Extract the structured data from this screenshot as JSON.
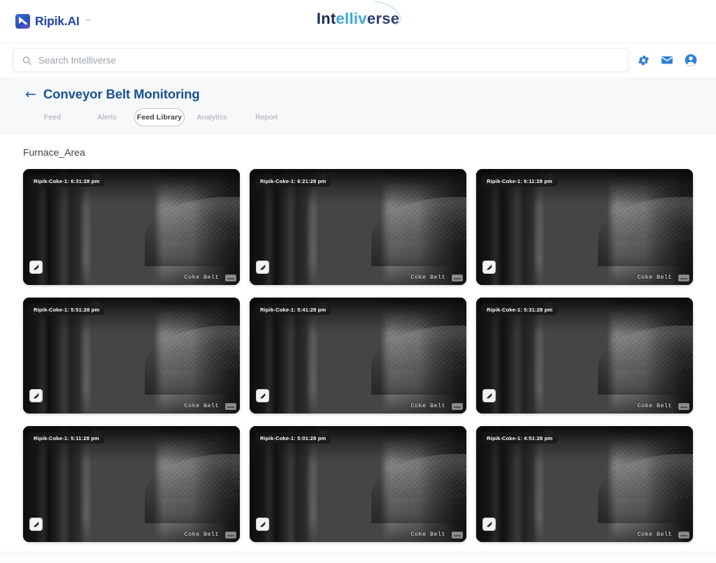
{
  "brand": {
    "ripik_name": "Ripik.AI",
    "ripik_tm": "™",
    "product_part1": "Int",
    "product_part2": "elliv",
    "product_part3": "erse",
    "product_full": "Intelliverse"
  },
  "search": {
    "placeholder": "Search Intelliverse",
    "value": ""
  },
  "header_icons": [
    {
      "name": "settings-icon",
      "label": "Settings"
    },
    {
      "name": "mail-icon",
      "label": "Messages"
    },
    {
      "name": "account-icon",
      "label": "Account"
    }
  ],
  "page": {
    "back_label": "←",
    "title": "Conveyor Belt Monitoring",
    "section_title": "Furnace_Area"
  },
  "tabs": [
    {
      "label": "Feed",
      "active": false
    },
    {
      "label": "Alerts",
      "active": false
    },
    {
      "label": "Feed Library",
      "active": true
    },
    {
      "label": "Analytics",
      "active": false
    },
    {
      "label": "Report",
      "active": false
    }
  ],
  "feed_cards": [
    {
      "stamp": "Ripik-Coke-1: 6:31:28 pm",
      "camera": "Ripik-Coke-1",
      "time": "6:31:28 pm",
      "watermark": "Coke Belt"
    },
    {
      "stamp": "Ripik-Coke-1: 6:21:28 pm",
      "camera": "Ripik-Coke-1",
      "time": "6:21:28 pm",
      "watermark": "Coke Belt"
    },
    {
      "stamp": "Ripik-Coke-1: 6:11:28 pm",
      "camera": "Ripik-Coke-1",
      "time": "6:11:28 pm",
      "watermark": "Coke Belt"
    },
    {
      "stamp": "Ripik-Coke-1: 5:51:28 pm",
      "camera": "Ripik-Coke-1",
      "time": "5:51:28 pm",
      "watermark": "Coke Belt"
    },
    {
      "stamp": "Ripik-Coke-1: 5:41:28 pm",
      "camera": "Ripik-Coke-1",
      "time": "5:41:28 pm",
      "watermark": "Coke Belt"
    },
    {
      "stamp": "Ripik-Coke-1: 5:31:28 pm",
      "camera": "Ripik-Coke-1",
      "time": "5:31:28 pm",
      "watermark": "Coke Belt"
    },
    {
      "stamp": "Ripik-Coke-1: 5:11:28 pm",
      "camera": "Ripik-Coke-1",
      "time": "5:11:28 pm",
      "watermark": "Coke Belt"
    },
    {
      "stamp": "Ripik-Coke-1: 5:01:28 pm",
      "camera": "Ripik-Coke-1",
      "time": "5:01:28 pm",
      "watermark": "Coke Belt"
    },
    {
      "stamp": "Ripik-Coke-1: 4:51:28 pm",
      "camera": "Ripik-Coke-1",
      "time": "4:51:28 pm",
      "watermark": "Coke Belt"
    }
  ],
  "colors": {
    "accent_blue": "#175293",
    "icon_blue": "#2f80d8",
    "band_bg": "#f7f8fa",
    "page_bg": "#ffffff",
    "muted_text": "#a3a8af"
  }
}
